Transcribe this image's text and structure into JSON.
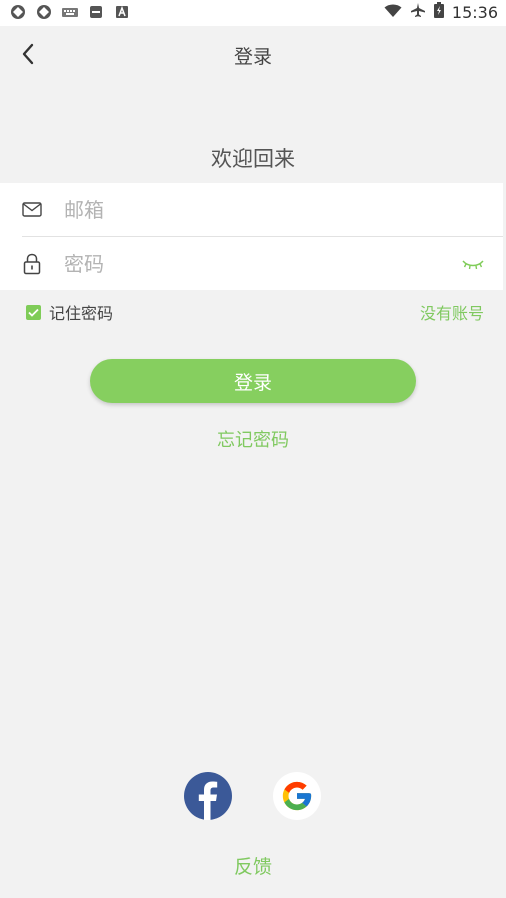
{
  "status_bar": {
    "time": "15:36"
  },
  "header": {
    "title": "登录"
  },
  "welcome": "欢迎回来",
  "form": {
    "email_placeholder": "邮箱",
    "password_placeholder": "密码",
    "remember_label": "记住密码",
    "remember_checked": true,
    "no_account_label": "没有账号"
  },
  "login_button": "登录",
  "forgot_password": "忘记密码",
  "social": {
    "facebook_icon": "facebook-icon",
    "google_icon": "google-icon"
  },
  "feedback": "反馈",
  "colors": {
    "accent": "#86cf5f",
    "link": "#80c960",
    "background": "#f2f2f2"
  }
}
